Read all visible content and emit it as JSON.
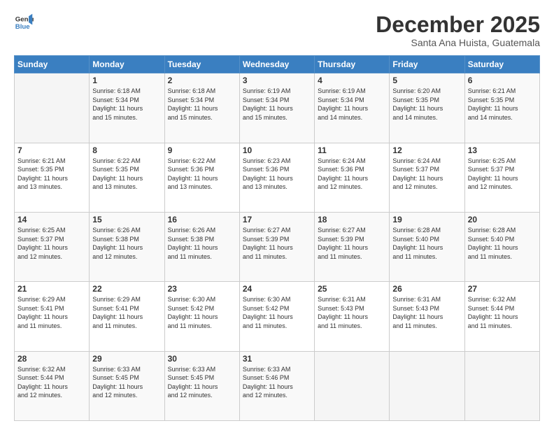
{
  "header": {
    "logo_line1": "General",
    "logo_line2": "Blue",
    "month": "December 2025",
    "location": "Santa Ana Huista, Guatemala"
  },
  "weekdays": [
    "Sunday",
    "Monday",
    "Tuesday",
    "Wednesday",
    "Thursday",
    "Friday",
    "Saturday"
  ],
  "weeks": [
    [
      {
        "day": "",
        "info": ""
      },
      {
        "day": "1",
        "info": "Sunrise: 6:18 AM\nSunset: 5:34 PM\nDaylight: 11 hours\nand 15 minutes."
      },
      {
        "day": "2",
        "info": "Sunrise: 6:18 AM\nSunset: 5:34 PM\nDaylight: 11 hours\nand 15 minutes."
      },
      {
        "day": "3",
        "info": "Sunrise: 6:19 AM\nSunset: 5:34 PM\nDaylight: 11 hours\nand 15 minutes."
      },
      {
        "day": "4",
        "info": "Sunrise: 6:19 AM\nSunset: 5:34 PM\nDaylight: 11 hours\nand 14 minutes."
      },
      {
        "day": "5",
        "info": "Sunrise: 6:20 AM\nSunset: 5:35 PM\nDaylight: 11 hours\nand 14 minutes."
      },
      {
        "day": "6",
        "info": "Sunrise: 6:21 AM\nSunset: 5:35 PM\nDaylight: 11 hours\nand 14 minutes."
      }
    ],
    [
      {
        "day": "7",
        "info": "Sunrise: 6:21 AM\nSunset: 5:35 PM\nDaylight: 11 hours\nand 13 minutes."
      },
      {
        "day": "8",
        "info": "Sunrise: 6:22 AM\nSunset: 5:35 PM\nDaylight: 11 hours\nand 13 minutes."
      },
      {
        "day": "9",
        "info": "Sunrise: 6:22 AM\nSunset: 5:36 PM\nDaylight: 11 hours\nand 13 minutes."
      },
      {
        "day": "10",
        "info": "Sunrise: 6:23 AM\nSunset: 5:36 PM\nDaylight: 11 hours\nand 13 minutes."
      },
      {
        "day": "11",
        "info": "Sunrise: 6:24 AM\nSunset: 5:36 PM\nDaylight: 11 hours\nand 12 minutes."
      },
      {
        "day": "12",
        "info": "Sunrise: 6:24 AM\nSunset: 5:37 PM\nDaylight: 11 hours\nand 12 minutes."
      },
      {
        "day": "13",
        "info": "Sunrise: 6:25 AM\nSunset: 5:37 PM\nDaylight: 11 hours\nand 12 minutes."
      }
    ],
    [
      {
        "day": "14",
        "info": "Sunrise: 6:25 AM\nSunset: 5:37 PM\nDaylight: 11 hours\nand 12 minutes."
      },
      {
        "day": "15",
        "info": "Sunrise: 6:26 AM\nSunset: 5:38 PM\nDaylight: 11 hours\nand 12 minutes."
      },
      {
        "day": "16",
        "info": "Sunrise: 6:26 AM\nSunset: 5:38 PM\nDaylight: 11 hours\nand 11 minutes."
      },
      {
        "day": "17",
        "info": "Sunrise: 6:27 AM\nSunset: 5:39 PM\nDaylight: 11 hours\nand 11 minutes."
      },
      {
        "day": "18",
        "info": "Sunrise: 6:27 AM\nSunset: 5:39 PM\nDaylight: 11 hours\nand 11 minutes."
      },
      {
        "day": "19",
        "info": "Sunrise: 6:28 AM\nSunset: 5:40 PM\nDaylight: 11 hours\nand 11 minutes."
      },
      {
        "day": "20",
        "info": "Sunrise: 6:28 AM\nSunset: 5:40 PM\nDaylight: 11 hours\nand 11 minutes."
      }
    ],
    [
      {
        "day": "21",
        "info": "Sunrise: 6:29 AM\nSunset: 5:41 PM\nDaylight: 11 hours\nand 11 minutes."
      },
      {
        "day": "22",
        "info": "Sunrise: 6:29 AM\nSunset: 5:41 PM\nDaylight: 11 hours\nand 11 minutes."
      },
      {
        "day": "23",
        "info": "Sunrise: 6:30 AM\nSunset: 5:42 PM\nDaylight: 11 hours\nand 11 minutes."
      },
      {
        "day": "24",
        "info": "Sunrise: 6:30 AM\nSunset: 5:42 PM\nDaylight: 11 hours\nand 11 minutes."
      },
      {
        "day": "25",
        "info": "Sunrise: 6:31 AM\nSunset: 5:43 PM\nDaylight: 11 hours\nand 11 minutes."
      },
      {
        "day": "26",
        "info": "Sunrise: 6:31 AM\nSunset: 5:43 PM\nDaylight: 11 hours\nand 11 minutes."
      },
      {
        "day": "27",
        "info": "Sunrise: 6:32 AM\nSunset: 5:44 PM\nDaylight: 11 hours\nand 11 minutes."
      }
    ],
    [
      {
        "day": "28",
        "info": "Sunrise: 6:32 AM\nSunset: 5:44 PM\nDaylight: 11 hours\nand 12 minutes."
      },
      {
        "day": "29",
        "info": "Sunrise: 6:33 AM\nSunset: 5:45 PM\nDaylight: 11 hours\nand 12 minutes."
      },
      {
        "day": "30",
        "info": "Sunrise: 6:33 AM\nSunset: 5:45 PM\nDaylight: 11 hours\nand 12 minutes."
      },
      {
        "day": "31",
        "info": "Sunrise: 6:33 AM\nSunset: 5:46 PM\nDaylight: 11 hours\nand 12 minutes."
      },
      {
        "day": "",
        "info": ""
      },
      {
        "day": "",
        "info": ""
      },
      {
        "day": "",
        "info": ""
      }
    ]
  ]
}
